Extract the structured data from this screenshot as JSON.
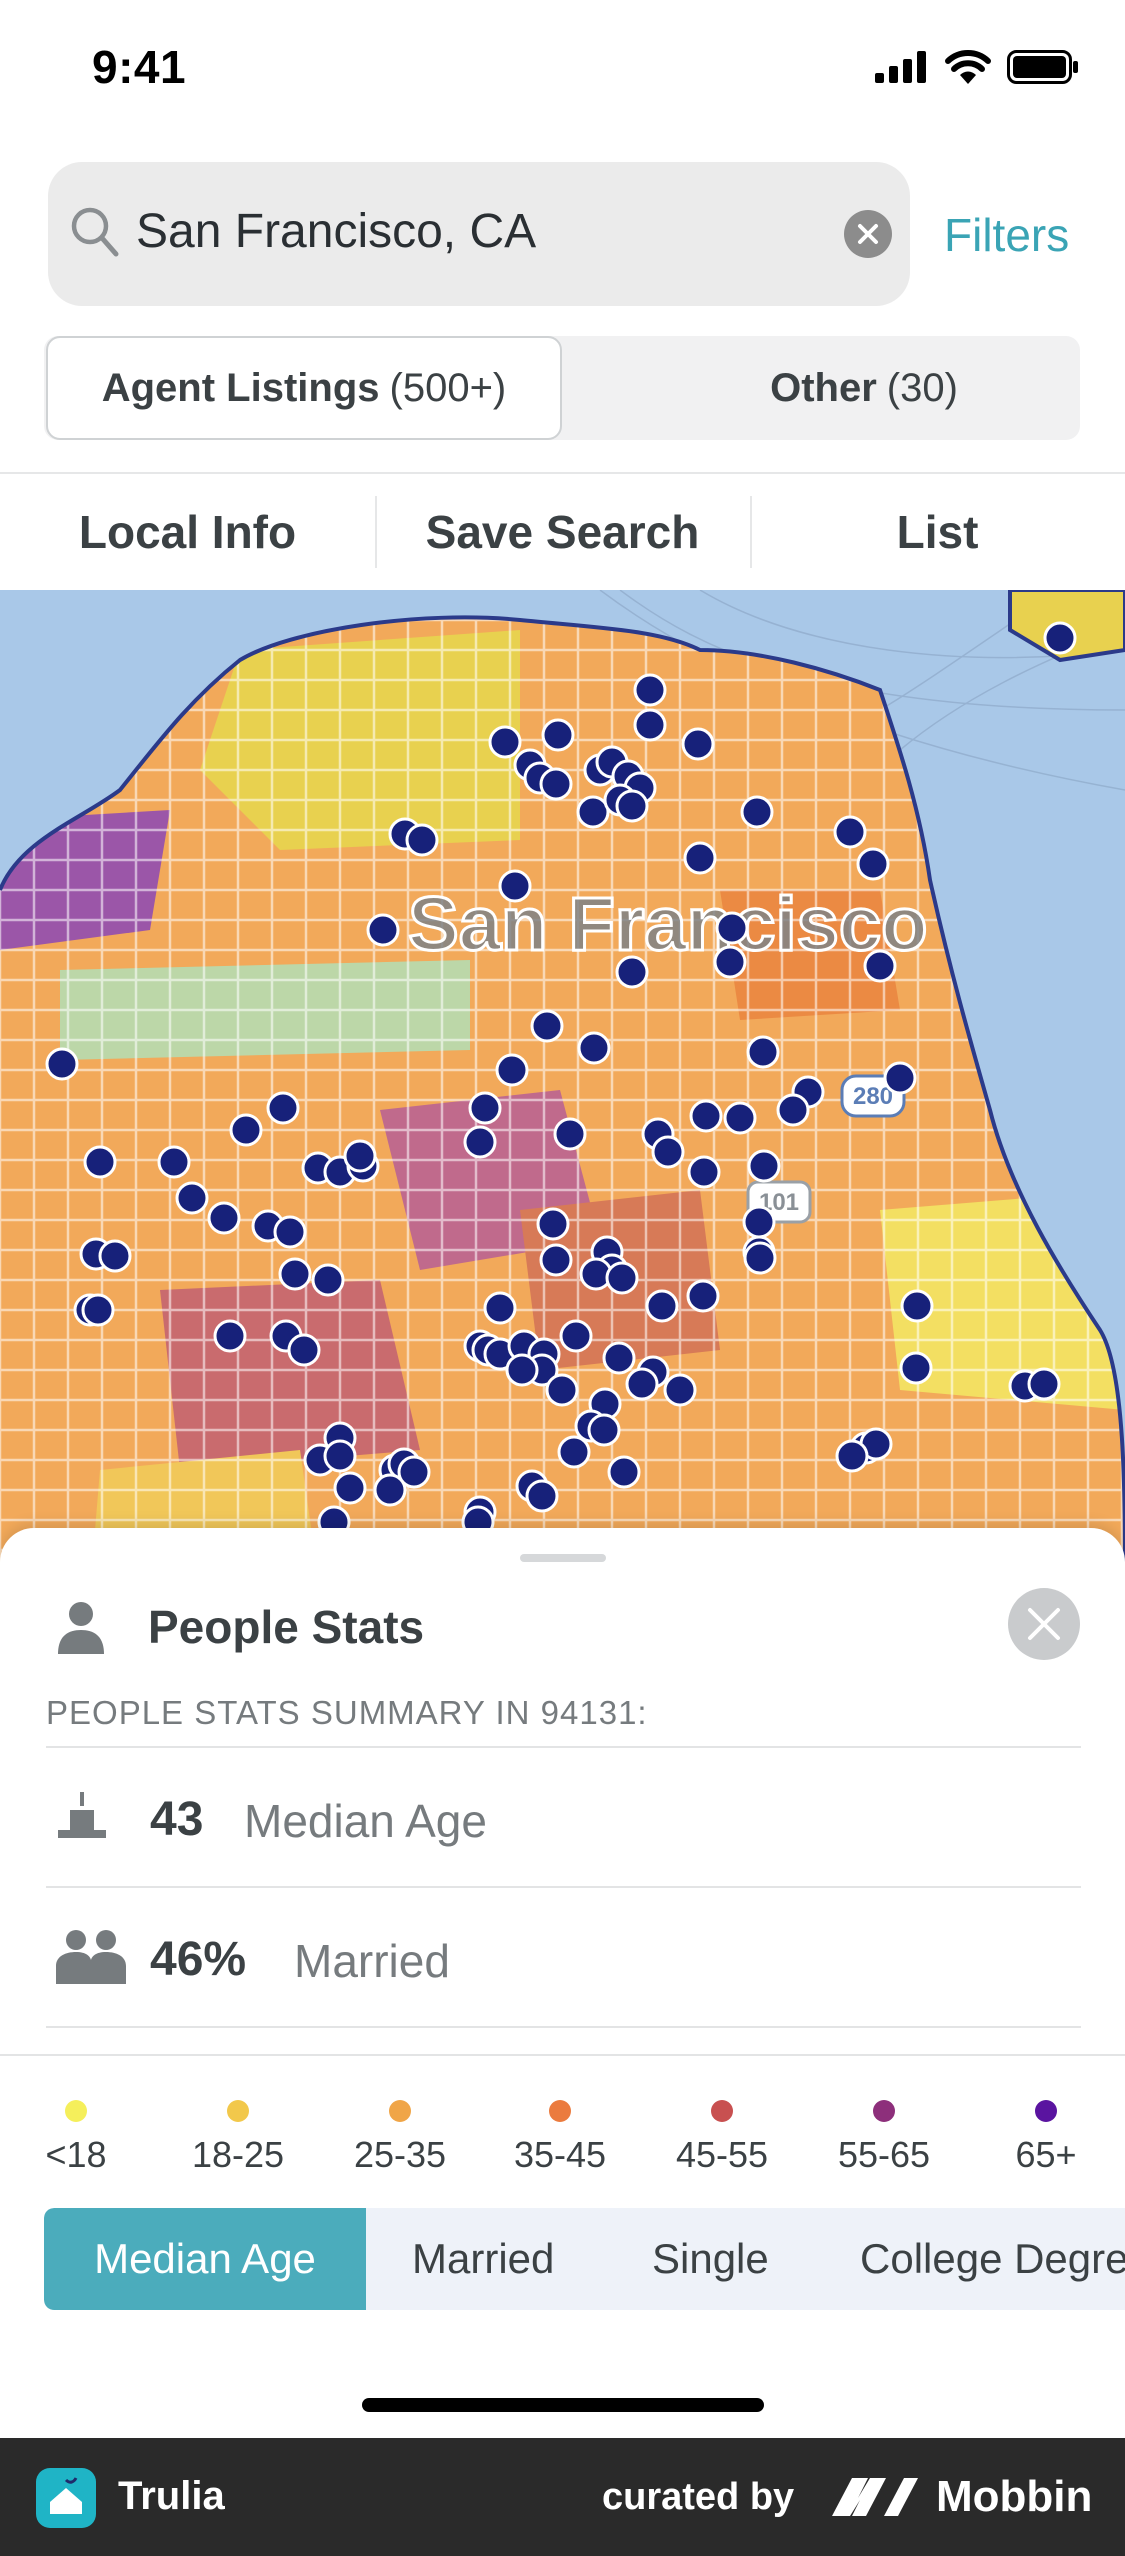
{
  "status_bar": {
    "time": "9:41",
    "icons": [
      "signal-icon",
      "wifi-icon",
      "battery-icon"
    ]
  },
  "search": {
    "value": "San Francisco, CA",
    "filters_label": "Filters"
  },
  "listing_tabs": [
    {
      "label": "Agent Listings",
      "count": "(500+)",
      "selected": true
    },
    {
      "label": "Other",
      "count": "(30)",
      "selected": false
    }
  ],
  "toolbar": {
    "local_info": "Local Info",
    "save_search": "Save Search",
    "list": "List"
  },
  "map": {
    "city_label": "San Francisco",
    "highway_shields": [
      "280",
      "101"
    ],
    "marker_color": "#17217a",
    "water_color": "#a9c8e8"
  },
  "people_stats": {
    "title": "People Stats",
    "summary_label": "PEOPLE STATS SUMMARY IN 94131:",
    "stats": [
      {
        "icon": "cake-icon",
        "value": "43",
        "label": "Median Age"
      },
      {
        "icon": "people-icon",
        "value": "46%",
        "label": "Married"
      }
    ]
  },
  "legend": [
    {
      "label": "<18",
      "color": "#f5ef5b"
    },
    {
      "label": "18-25",
      "color": "#f2c84b"
    },
    {
      "label": "25-35",
      "color": "#f0a547"
    },
    {
      "label": "35-45",
      "color": "#eb7b3e"
    },
    {
      "label": "45-55",
      "color": "#c85050"
    },
    {
      "label": "55-65",
      "color": "#8d2f7b"
    },
    {
      "label": "65+",
      "color": "#5a14a0"
    }
  ],
  "metric_tabs": [
    {
      "label": "Median Age",
      "selected": true
    },
    {
      "label": "Married",
      "selected": false
    },
    {
      "label": "Single",
      "selected": false
    },
    {
      "label": "College Degree",
      "selected": false
    }
  ],
  "footer": {
    "app_name": "Trulia",
    "curated_by": "curated by",
    "brand": "Mobbin"
  }
}
